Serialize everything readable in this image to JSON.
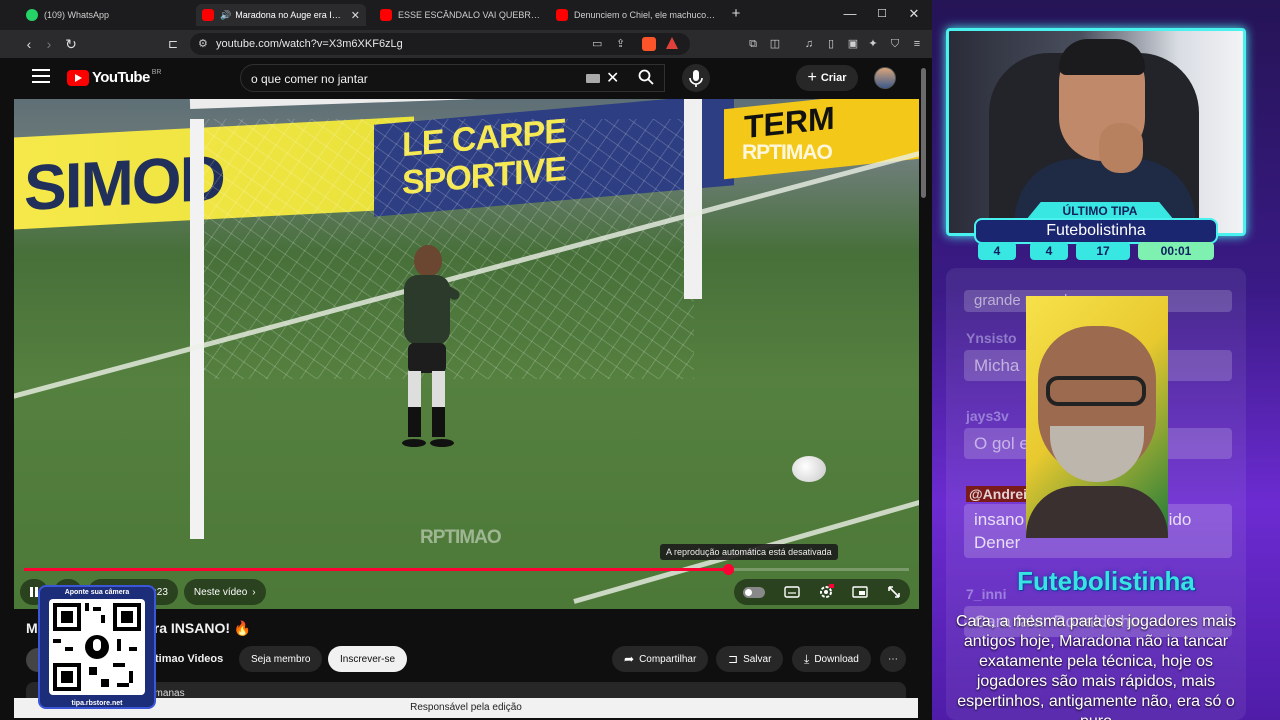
{
  "browser": {
    "tabs": [
      {
        "title": "(109) WhatsApp",
        "favicon": "whatsapp-icon",
        "color": "#25d366",
        "active": false
      },
      {
        "title": "Maradona no Auge era INSANO! 🔥",
        "favicon": "youtube-icon",
        "color": "#ff0000",
        "active": true
      },
      {
        "title": "ESSE ESCÂNDALO VAI QUEBRAR O BRASIL E",
        "favicon": "youtube-icon",
        "color": "#ff0000",
        "active": false
      },
      {
        "title": "Denunciem o Chiel, ele machucou meus ser",
        "favicon": "youtube-icon",
        "color": "#ff0000",
        "active": false
      }
    ],
    "url": "youtube.com/watch?v=X3m6XKF6zLg",
    "status_text": "Responsável pela edição"
  },
  "youtube": {
    "logo_text": "YouTube",
    "country_code": "BR",
    "search_value": "o que comer no jantar",
    "create_label": "Criar",
    "player": {
      "tooltip": "A reprodução automática está desativada",
      "time": "1:23",
      "next_label": "Neste vídeo",
      "progress": 0.795,
      "watermark": "RPTIMAO",
      "banners": [
        "SIMOD",
        "LE CARPE SPORTIVE",
        "TERM"
      ]
    },
    "video_title_visible_start": "M",
    "video_title_visible_end": "era INSANO! 🔥",
    "channel_name_visible": "timao Videos",
    "join_label": "Seja membro",
    "subscribe_label": "Inscrever-se",
    "share_label": "Compartilhar",
    "save_label": "Salvar",
    "download_label": "Download",
    "desc_visible": "semanas"
  },
  "qr": {
    "top_text": "Aponte sua câmera",
    "bottom_text": "tipa.rbstore.net"
  },
  "stream": {
    "badge_label": "ÚLTIMO TIPA",
    "last_tipper": "Futebolistinha",
    "stats": [
      "4",
      "4",
      "17",
      "00:01"
    ],
    "chat": [
      {
        "user": "",
        "msg": "grande maradona"
      },
      {
        "user": "Ynsisto",
        "msg": "Micha"
      },
      {
        "user": "jays3v",
        "msg": "O gol e m"
      },
      {
        "user": "@Andrei.Martins",
        "msg": "insano mesmo era o falecido Dener"
      },
      {
        "user": "7_inni",
        "msg": "Cara falar Ronaldinho"
      }
    ],
    "tts_user": "Futebolistinha",
    "tts_message": "Cara, a mesma para os jogadores mais antigos hoje, Maradona não ia tancar exatamente pela técnica, hoje os jogadores são mais rápidos, mais espertinhos, antigamente não, era só o puro"
  }
}
